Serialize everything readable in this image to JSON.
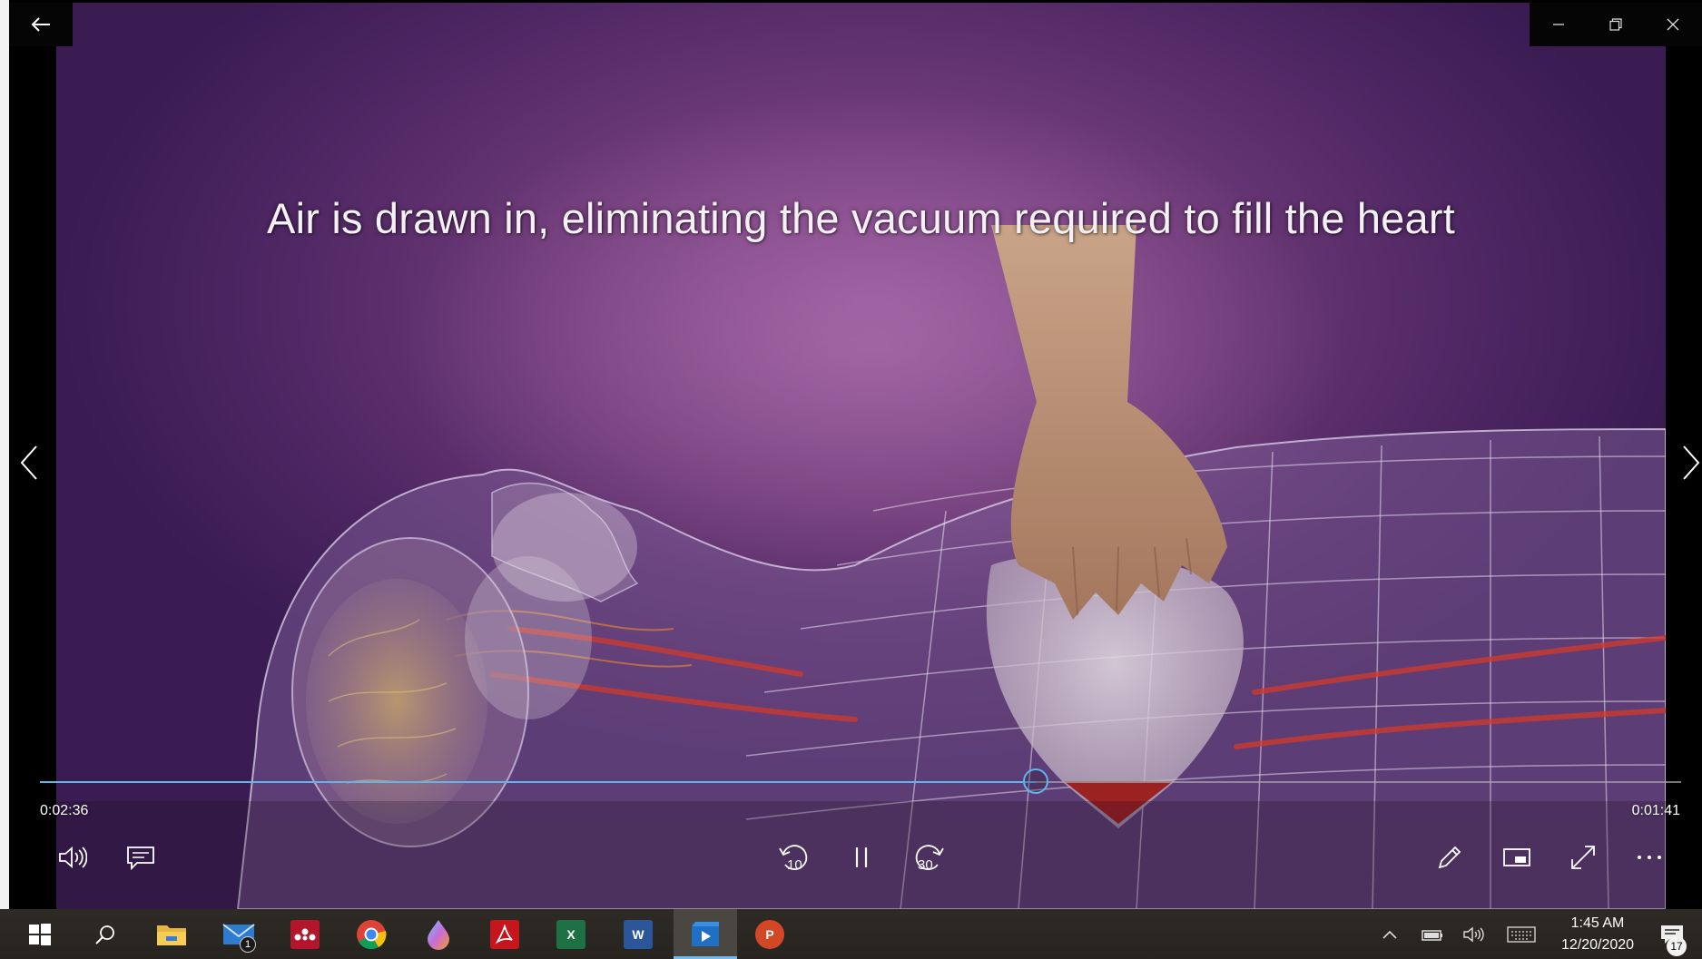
{
  "video": {
    "caption": "Air is drawn in, eliminating the vacuum required to fill the heart",
    "progress_fraction": 0.607
  },
  "controls": {
    "time_elapsed": "0:02:36",
    "time_remaining": "0:01:41",
    "skip_back_label": "10",
    "skip_forward_label": "30",
    "accent_color": "#5cb6f0"
  },
  "taskbar": {
    "apps": [
      {
        "id": "start",
        "icon": "windows-logo-icon"
      },
      {
        "id": "search",
        "icon": "search-icon"
      },
      {
        "id": "file-explorer",
        "icon": "folder-icon"
      },
      {
        "id": "mail",
        "icon": "mail-icon",
        "badge": "1"
      },
      {
        "id": "mendeley",
        "icon": "mendeley-icon"
      },
      {
        "id": "chrome",
        "icon": "chrome-icon"
      },
      {
        "id": "paint",
        "icon": "paint-drop-icon"
      },
      {
        "id": "acrobat",
        "icon": "acrobat-icon"
      },
      {
        "id": "excel",
        "icon": "excel-icon",
        "letter": "X"
      },
      {
        "id": "word",
        "icon": "word-icon",
        "letter": "W"
      },
      {
        "id": "movies-tv",
        "icon": "video-player-icon"
      },
      {
        "id": "powerpoint",
        "icon": "powerpoint-icon",
        "letter": "P"
      }
    ],
    "clock_time": "1:45 AM",
    "clock_date": "12/20/2020",
    "notification_count": "17"
  }
}
